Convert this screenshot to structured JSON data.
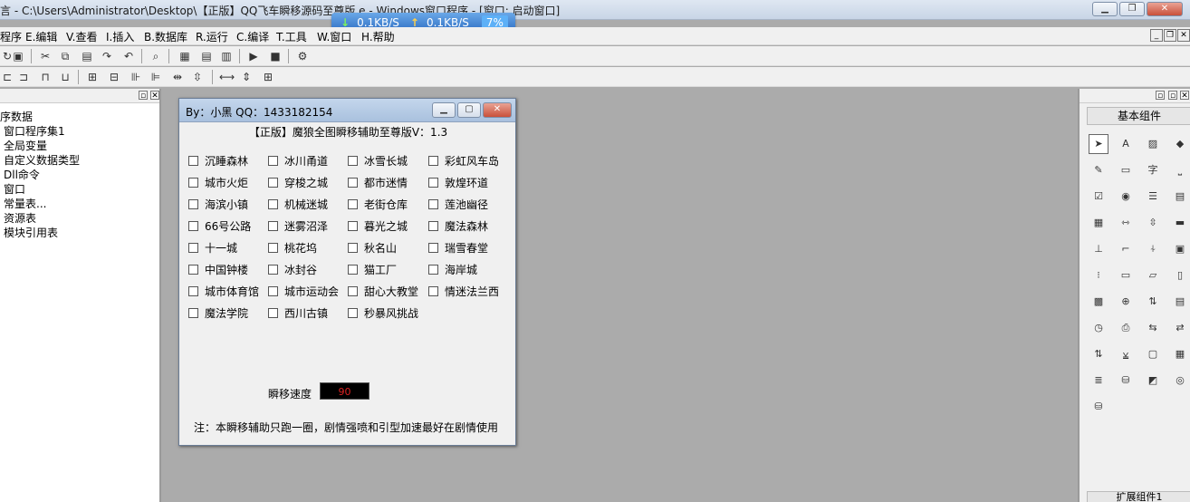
{
  "title": "言 - C:\\Users\\Administrator\\Desktop\\【正版】QQ飞车瞬移源码至尊版.e - Windows窗口程序 - [窗口: 启动窗口]",
  "speed_widget": {
    "download": "0.1KB/S",
    "upload": "0.1KB/S",
    "percent": "7%"
  },
  "menu": [
    "程序",
    "E.编辑",
    "V.查看",
    "I.插入",
    "B.数据库",
    "R.运行",
    "C.编译",
    "T.工具",
    "W.窗口",
    "H.帮助"
  ],
  "tree": [
    "序数据",
    "窗口程序集1",
    "全局变量",
    "自定义数据类型",
    "Dll命令",
    "窗口",
    "常量表...",
    "资源表",
    "模块引用表"
  ],
  "right_panel": {
    "basic_title": "基本组件",
    "ext_title": "扩展组件1"
  },
  "dialog": {
    "title": "By：小黑  QQ：1433182154",
    "heading": "【正版】魔狼全图瞬移辅助至尊版V：1.3",
    "checkboxes": [
      [
        "沉睡森林",
        "冰川甬道",
        "冰雪长城",
        "彩虹风车岛"
      ],
      [
        "城市火炬",
        "穿梭之城",
        "都市迷情",
        "敦煌环道"
      ],
      [
        "海滨小镇",
        "机械迷城",
        "老街仓库",
        "莲池幽径"
      ],
      [
        "66号公路",
        "迷雾沼泽",
        "暮光之城",
        "魔法森林"
      ],
      [
        "十一城",
        "桃花坞",
        "秋名山",
        "瑞雪春堂"
      ],
      [
        "中国钟楼",
        "冰封谷",
        "猫工厂",
        "海岸城"
      ],
      [
        "城市体育馆",
        "城市运动会",
        "甜心大教堂",
        "情迷法兰西"
      ],
      [
        "魔法学院",
        "西川古镇",
        "秒暴风挑战"
      ]
    ],
    "speed_label": "瞬移速度",
    "speed_value": "90",
    "note": "注：本瞬移辅助只跑一圈，剧情强喷和引型加速最好在剧情使用"
  }
}
